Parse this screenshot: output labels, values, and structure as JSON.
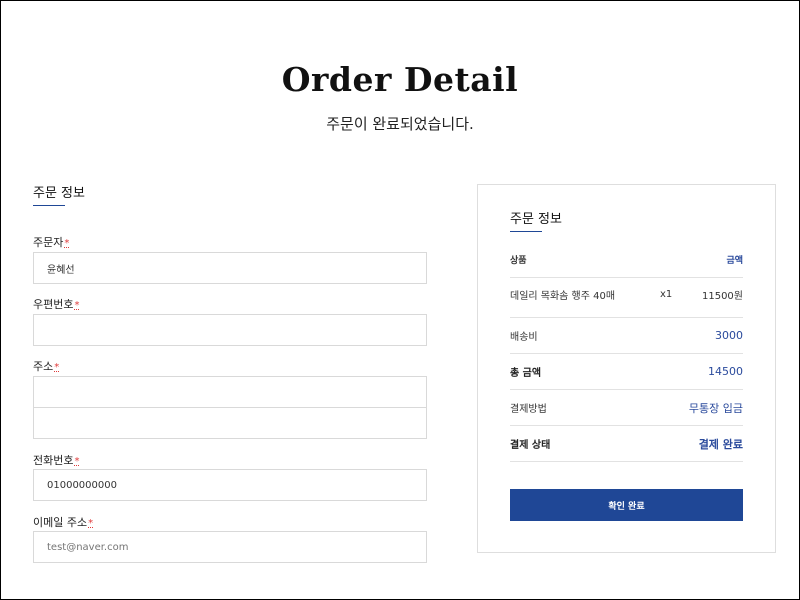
{
  "header": {
    "title": "Order Detail",
    "subtitle": "주문이 완료되었습니다."
  },
  "order_form": {
    "section_title": "주문 정보",
    "required_mark": "*",
    "orderer": {
      "label": "주문자",
      "value": "윤혜선"
    },
    "postal_code": {
      "label": "우편번호",
      "value": ""
    },
    "address": {
      "label": "주소",
      "line1": "",
      "line2": ""
    },
    "phone": {
      "label": "전화번호",
      "value": "01000000000"
    },
    "email": {
      "label": "이메일 주소",
      "placeholder": "test@naver.com"
    }
  },
  "summary": {
    "section_title": "주문 정보",
    "header": {
      "product": "상품",
      "amount": "금액"
    },
    "product": {
      "name": "데일리 목화솜 행주 40매",
      "quantity": "x1",
      "price": "11500원"
    },
    "shipping": {
      "label": "배송비",
      "value": "3000"
    },
    "total": {
      "label": "총 금액",
      "value": "14500"
    },
    "payment_method": {
      "label": "결제방법",
      "value": "무통장 입금"
    },
    "payment_status": {
      "label": "결제 상태",
      "value": "결제 완료"
    },
    "confirm_button": "확인 완료"
  },
  "colors": {
    "accent": "#1f4796",
    "required": "#e03a3a",
    "border": "#d9d9d9"
  }
}
